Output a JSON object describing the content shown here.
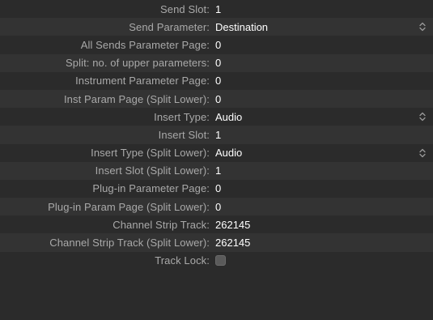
{
  "parameters": [
    {
      "label": "Send Slot:",
      "value": "1",
      "control": "text"
    },
    {
      "label": "Send Parameter:",
      "value": "Destination",
      "control": "popup"
    },
    {
      "label": "All Sends Parameter Page:",
      "value": "0",
      "control": "text"
    },
    {
      "label": "Split: no. of upper parameters:",
      "value": "0",
      "control": "text"
    },
    {
      "label": "Instrument Parameter Page:",
      "value": "0",
      "control": "text"
    },
    {
      "label": "Inst Param Page (Split Lower):",
      "value": "0",
      "control": "text"
    },
    {
      "label": "Insert Type:",
      "value": "Audio",
      "control": "popup"
    },
    {
      "label": "Insert Slot:",
      "value": "1",
      "control": "text"
    },
    {
      "label": "Insert Type (Split Lower):",
      "value": "Audio",
      "control": "popup"
    },
    {
      "label": "Insert Slot (Split Lower):",
      "value": "1",
      "control": "text"
    },
    {
      "label": "Plug-in Parameter Page:",
      "value": "0",
      "control": "text"
    },
    {
      "label": "Plug-in Param Page (Split Lower):",
      "value": "0",
      "control": "text"
    },
    {
      "label": "Channel Strip Track:",
      "value": "262145",
      "control": "text"
    },
    {
      "label": "Channel Strip Track (Split Lower):",
      "value": "262145",
      "control": "text"
    },
    {
      "label": "Track Lock:",
      "checked": false,
      "control": "checkbox"
    }
  ],
  "colors": {
    "background": "#2b2b2b",
    "stripe": "#333333",
    "label": "#a9a9a9",
    "value": "#ffffff"
  },
  "icons": {
    "popup_stepper": "up-down-chevron-icon"
  }
}
